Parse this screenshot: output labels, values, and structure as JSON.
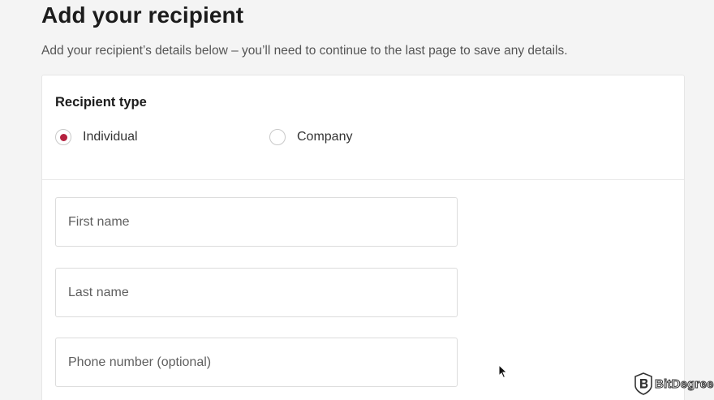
{
  "page": {
    "title": "Add your recipient",
    "subtitle": "Add your recipient’s details below – you’ll need to continue to the last page to save any details."
  },
  "recipient_type": {
    "heading": "Recipient type",
    "options": [
      {
        "label": "Individual",
        "selected": true
      },
      {
        "label": "Company",
        "selected": false
      }
    ]
  },
  "fields": {
    "first_name": {
      "placeholder": "First name",
      "value": ""
    },
    "last_name": {
      "placeholder": "Last name",
      "value": ""
    },
    "phone_number": {
      "placeholder": "Phone number (optional)",
      "value": ""
    }
  },
  "watermark": {
    "text": "BitDegree"
  },
  "colors": {
    "accent": "#b5213f",
    "background": "#f4f4f4",
    "card": "#ffffff"
  },
  "icons": [
    "radio-selected-icon",
    "radio-unselected-icon",
    "mouse-pointer-icon",
    "bitdegree-logo-icon"
  ]
}
